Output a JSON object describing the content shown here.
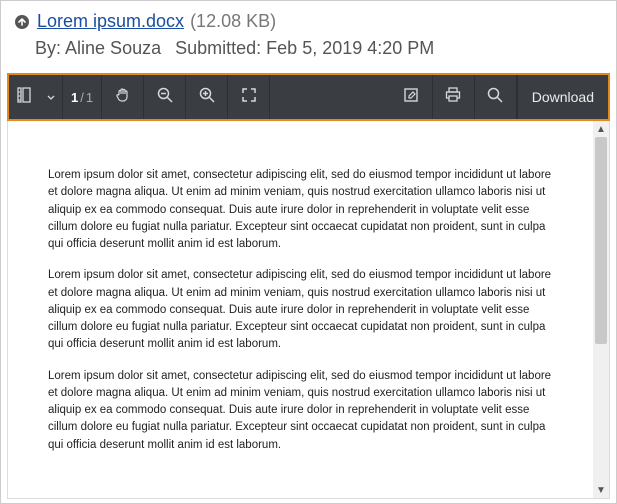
{
  "header": {
    "file_name": "Lorem ipsum.docx",
    "file_size": "(12.08 KB)",
    "by_label": "By:",
    "author": "Aline Souza",
    "submitted_label": "Submitted:",
    "submitted_value": "Feb 5, 2019 4:20 PM"
  },
  "toolbar": {
    "page_current": "1",
    "page_sep": "/",
    "page_total": "1",
    "download_label": "Download",
    "icons": {
      "thumbnails": "thumbnails-icon",
      "dropdown": "chevron-down-icon",
      "pan": "hand-icon",
      "zoom_out": "zoom-out-icon",
      "zoom_in": "zoom-in-icon",
      "fullscreen": "fullscreen-icon",
      "edit": "edit-icon",
      "print": "print-icon",
      "search": "search-icon"
    }
  },
  "document": {
    "paragraphs": [
      "Lorem ipsum dolor sit amet, consectetur adipiscing elit, sed do eiusmod tempor incididunt ut labore et dolore magna aliqua. Ut enim ad minim veniam, quis nostrud exercitation ullamco laboris nisi ut aliquip ex ea commodo consequat. Duis aute irure dolor in reprehenderit in voluptate velit esse cillum dolore eu fugiat nulla pariatur. Excepteur sint occaecat cupidatat non proident, sunt in culpa qui officia deserunt mollit anim id est laborum.",
      "Lorem ipsum dolor sit amet, consectetur adipiscing elit, sed do eiusmod tempor incididunt ut labore et dolore magna aliqua. Ut enim ad minim veniam, quis nostrud exercitation ullamco laboris nisi ut aliquip ex ea commodo consequat. Duis aute irure dolor in reprehenderit in voluptate velit esse cillum dolore eu fugiat nulla pariatur. Excepteur sint occaecat cupidatat non proident, sunt in culpa qui officia deserunt mollit anim id est laborum.",
      "Lorem ipsum dolor sit amet, consectetur adipiscing elit, sed do eiusmod tempor incididunt ut labore et dolore magna aliqua. Ut enim ad minim veniam, quis nostrud exercitation ullamco laboris nisi ut aliquip ex ea commodo consequat. Duis aute irure dolor in reprehenderit in voluptate velit esse cillum dolore eu fugiat nulla pariatur. Excepteur sint occaecat cupidatat non proident, sunt in culpa qui officia deserunt mollit anim id est laborum."
    ]
  }
}
